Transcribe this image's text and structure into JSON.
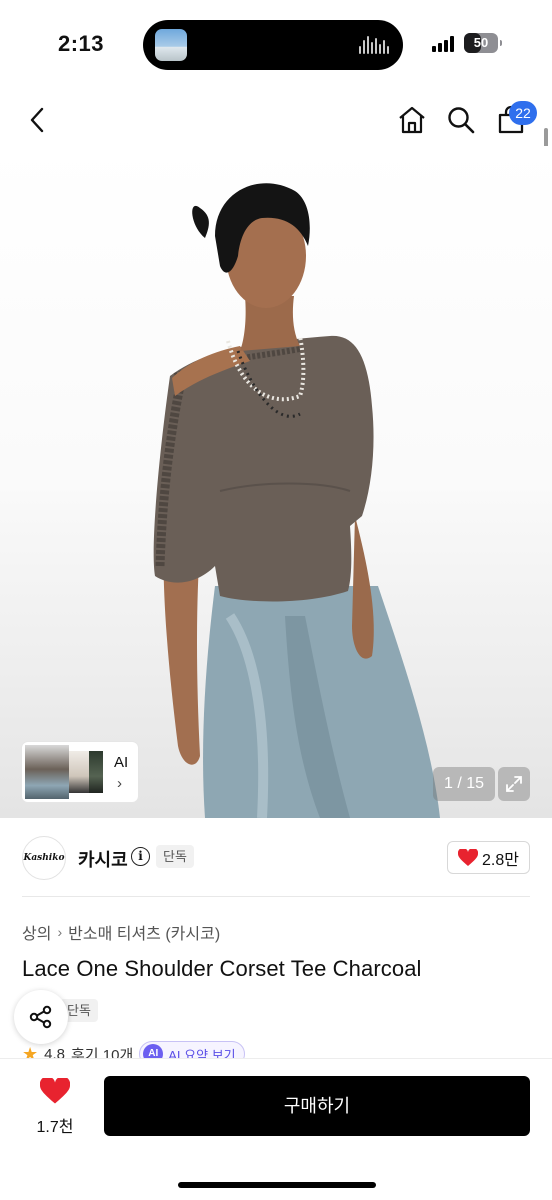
{
  "status_bar": {
    "time": "2:13",
    "battery": "50",
    "battery_level_percent": 50,
    "signal_bars": 4
  },
  "nav": {
    "back_icon": "chevron-left-icon",
    "home_icon": "home-icon",
    "search_icon": "search-icon",
    "cart_icon": "shopping-bag-icon",
    "cart_count": "22"
  },
  "gallery": {
    "thumb_label": "AI",
    "thumb_arrow": "›",
    "counter": "1 / 15",
    "expand_icon": "expand-icon"
  },
  "brand": {
    "logo_text": "Kashiko",
    "name": "카시코",
    "exclusive_label": "단독",
    "likes": "2.8만"
  },
  "product": {
    "breadcrumb": [
      "상의",
      "반소매 티셔츠 (카시코)"
    ],
    "breadcrumb_sep": "›",
    "title": "Lace One Shoulder Corset Tee Charcoal",
    "exclusive_label": "단독",
    "rating": "4.8",
    "reviews": "후기 10개",
    "ai_badge": "AI",
    "ai_summary": "AI 요약 보기"
  },
  "bottom_bar": {
    "wish_count": "1.7천",
    "buy_label": "구매하기"
  },
  "colors": {
    "accent_blue": "#2f6fed",
    "heart_red": "#e8232f",
    "ai_purple": "#6c5ff0",
    "buy_button": "#000000"
  }
}
